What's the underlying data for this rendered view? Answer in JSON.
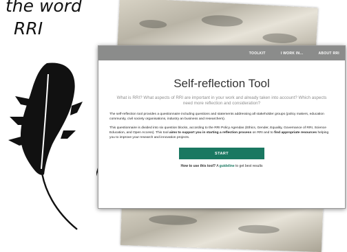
{
  "slide": {
    "title_line1": "the word",
    "title_line2": "RRI"
  },
  "nav": {
    "items": [
      "TOOLKIT",
      "I WORK IN...",
      "ABOUT RRI"
    ]
  },
  "tool": {
    "title": "Self-reflection Tool",
    "subtitle": "What is RRI? What aspects of RRI are important in your work and already taken into account? Which aspects need more reflection and consideration?",
    "para1": "The self-reflection tool provides a questionnaire including questions and statements addressing all stakeholder groups (policy makers, education community, civil society organisations, industry an business and researchers).",
    "para2_a": "This questionnaire is divided into six question blocks, according to the RRI Policy Agendas (Ethics, Gender, Equality, Governance of RRI, Science Education, and Open Access). This tool ",
    "para2_b": "aims to support you in starting a reflection process",
    "para2_c": " on RRI and to ",
    "para2_d": "find appropriate resources",
    "para2_e": " helping you to improve your research and innovation projects.",
    "start_label": "START",
    "howto_q": "How to use this tool?",
    "howto_a": " A ",
    "howto_link": "guideline",
    "howto_b": " to get best results"
  },
  "colors": {
    "navbar": "#8b8c8b",
    "accent": "#1a7861"
  },
  "icons": {
    "feather": "feather-icon"
  }
}
